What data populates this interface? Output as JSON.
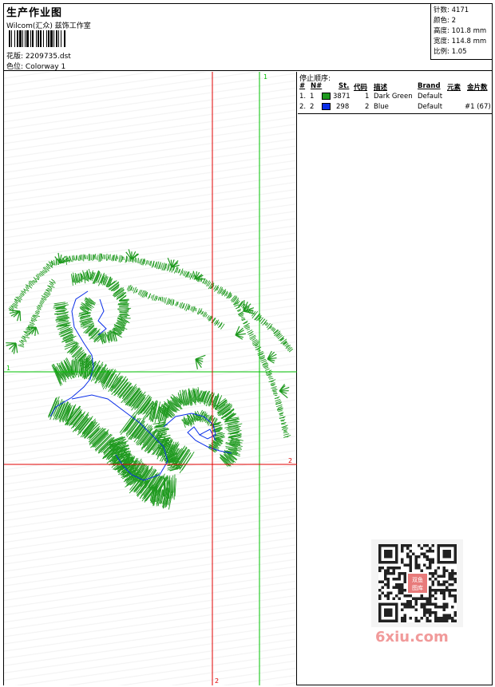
{
  "header": {
    "title": "生产作业图",
    "subtitle": "Wilcom(汇众) 兹饰工作室",
    "design_label": "花版:",
    "design_value": "2209735.dst",
    "colorway_label": "色位:",
    "colorway_value": "Colorway 1"
  },
  "stats": [
    {
      "label": "针数:",
      "value": "4171"
    },
    {
      "label": "颜色:",
      "value": "2"
    },
    {
      "label": "高度:",
      "value": "101.8 mm"
    },
    {
      "label": "宽度:",
      "value": "114.8 mm"
    },
    {
      "label": "比例:",
      "value": "1.05"
    }
  ],
  "stop_sequence": {
    "title": "停止顺序:",
    "columns": [
      "#",
      "N#",
      "St.",
      "代码",
      "描述",
      "Brand",
      "元素",
      "金片数"
    ],
    "rows": [
      {
        "index": "1.",
        "needle": "1",
        "color": "#1f9a1f",
        "stitches": "3871",
        "code": "1",
        "description": "Dark Green",
        "brand": "Default",
        "element": ""
      },
      {
        "index": "2.",
        "needle": "2",
        "color": "#0a2ee8",
        "stitches": "298",
        "code": "2",
        "description": "Blue",
        "brand": "Default",
        "element": "#1 (67)"
      }
    ]
  },
  "guides": {
    "green_top": "1",
    "green_left": "1",
    "red_right": "2",
    "red_bottom": "2",
    "green_color": "#00c000",
    "red_color": "#e00000"
  },
  "watermark": {
    "text": "6xiu.com",
    "qr_stamp": "双鱼图库"
  }
}
